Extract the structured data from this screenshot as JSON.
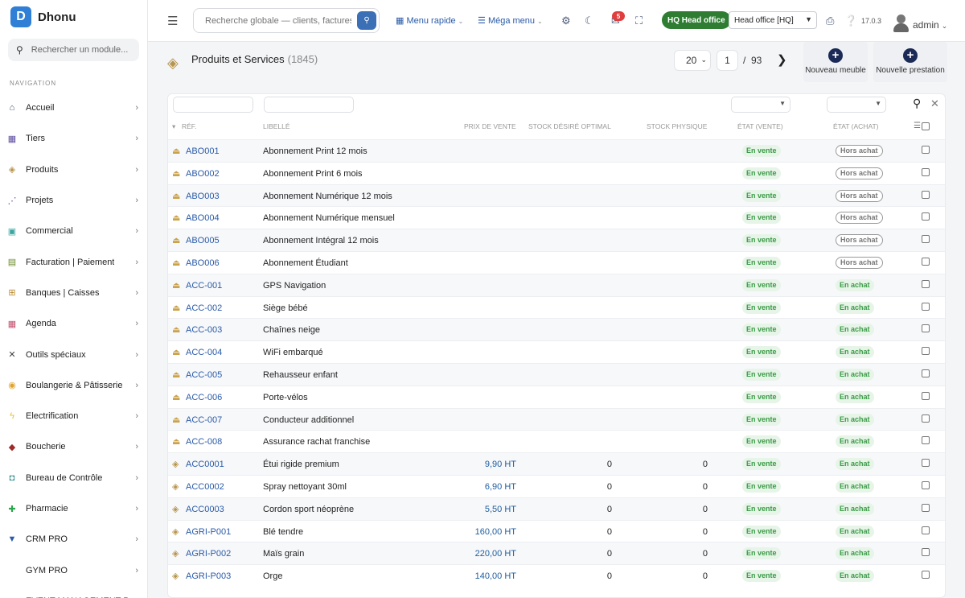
{
  "app": {
    "name": "Dhonu",
    "logo_letter": "D"
  },
  "sidebar": {
    "search_placeholder": "Rechercher un module...",
    "section_title": "NAVIGATION",
    "items": [
      {
        "label": "Accueil",
        "icon": "home-icon",
        "color": "#3b4a6b",
        "glyph": "⌂"
      },
      {
        "label": "Tiers",
        "icon": "building-icon",
        "color": "#5b4a9e",
        "glyph": "▦"
      },
      {
        "label": "Produits",
        "icon": "box-icon",
        "color": "#b8954e",
        "glyph": "◈"
      },
      {
        "label": "Projets",
        "icon": "project-icon",
        "color": "#6a4a9e",
        "glyph": "⋰"
      },
      {
        "label": "Commercial",
        "icon": "briefcase-icon",
        "color": "#3aa6a0",
        "glyph": "▣"
      },
      {
        "label": "Facturation | Paiement",
        "icon": "invoice-icon",
        "color": "#6a8a2a",
        "glyph": "▤"
      },
      {
        "label": "Banques | Caisses",
        "icon": "bank-icon",
        "color": "#b88a2e",
        "glyph": "⊞"
      },
      {
        "label": "Agenda",
        "icon": "calendar-icon",
        "color": "#c0506e",
        "glyph": "▦"
      },
      {
        "label": "Outils spéciaux",
        "icon": "tools-icon",
        "color": "#444",
        "glyph": "✕"
      },
      {
        "label": "Boulangerie & Pâtisserie",
        "icon": "bread-icon",
        "color": "#e0a42e",
        "glyph": "◉"
      },
      {
        "label": "Electrification",
        "icon": "lightning-icon",
        "color": "#e8c12a",
        "glyph": "ϟ"
      },
      {
        "label": "Boucherie",
        "icon": "meat-icon",
        "color": "#9e2a2a",
        "glyph": "◆"
      },
      {
        "label": "Bureau de Contrôle",
        "icon": "control-icon",
        "color": "#2a8a8a",
        "glyph": "◘"
      },
      {
        "label": "Pharmacie",
        "icon": "pharmacy-cross-icon",
        "color": "#2aa64a",
        "glyph": "✚"
      },
      {
        "label": "CRM PRO",
        "icon": "filter-icon",
        "color": "#2a5ba8",
        "glyph": "▼"
      },
      {
        "label": "GYM PRO",
        "icon": "",
        "color": "#fff",
        "glyph": ""
      },
      {
        "label": "EVENT MANAGEMENT P...",
        "icon": "event-icon",
        "color": "#6a3a9e",
        "glyph": "▬"
      }
    ]
  },
  "topbar": {
    "search_placeholder": "Recherche globale — clients, factures, p",
    "menu_rapide": "Menu rapide",
    "mega_menu": "Méga menu",
    "notif_count": "5",
    "hq_badge": "HQ Head office",
    "entity_select": "Head office [HQ]",
    "version": "17.0.3",
    "username": "admin"
  },
  "page": {
    "title": "Produits et Services",
    "count": "(1845)",
    "limit": "20",
    "current_page": "1",
    "page_sep": "/",
    "total_pages": "93",
    "btn_new_furniture": "Nouveau meuble",
    "btn_new_service": "Nouvelle prestation"
  },
  "table": {
    "headers": {
      "ref": "RÉF.",
      "label": "LIBELLÉ",
      "price": "PRIX DE VENTE",
      "stock_desired": "STOCK DÉSIRÉ OPTIMAL",
      "stock_physical": "STOCK PHYSIQUE",
      "state_sell": "ÉTAT (VENTE)",
      "state_buy": "ÉTAT (ACHAT)"
    },
    "rows": [
      {
        "ref": "ABO001",
        "label": "Abonnement Print 12 mois",
        "price": "",
        "stock_desired": "",
        "stock_physical": "",
        "sell": "En vente",
        "buy": "Hors achat",
        "type": "service"
      },
      {
        "ref": "ABO002",
        "label": "Abonnement Print 6 mois",
        "price": "",
        "stock_desired": "",
        "stock_physical": "",
        "sell": "En vente",
        "buy": "Hors achat",
        "type": "service"
      },
      {
        "ref": "ABO003",
        "label": "Abonnement Numérique 12 mois",
        "price": "",
        "stock_desired": "",
        "stock_physical": "",
        "sell": "En vente",
        "buy": "Hors achat",
        "type": "service"
      },
      {
        "ref": "ABO004",
        "label": "Abonnement Numérique mensuel",
        "price": "",
        "stock_desired": "",
        "stock_physical": "",
        "sell": "En vente",
        "buy": "Hors achat",
        "type": "service"
      },
      {
        "ref": "ABO005",
        "label": "Abonnement Intégral 12 mois",
        "price": "",
        "stock_desired": "",
        "stock_physical": "",
        "sell": "En vente",
        "buy": "Hors achat",
        "type": "service"
      },
      {
        "ref": "ABO006",
        "label": "Abonnement Étudiant",
        "price": "",
        "stock_desired": "",
        "stock_physical": "",
        "sell": "En vente",
        "buy": "Hors achat",
        "type": "service"
      },
      {
        "ref": "ACC-001",
        "label": "GPS Navigation",
        "price": "",
        "stock_desired": "",
        "stock_physical": "",
        "sell": "En vente",
        "buy": "En achat",
        "type": "service"
      },
      {
        "ref": "ACC-002",
        "label": "Siège bébé",
        "price": "",
        "stock_desired": "",
        "stock_physical": "",
        "sell": "En vente",
        "buy": "En achat",
        "type": "service"
      },
      {
        "ref": "ACC-003",
        "label": "Chaînes neige",
        "price": "",
        "stock_desired": "",
        "stock_physical": "",
        "sell": "En vente",
        "buy": "En achat",
        "type": "service"
      },
      {
        "ref": "ACC-004",
        "label": "WiFi embarqué",
        "price": "",
        "stock_desired": "",
        "stock_physical": "",
        "sell": "En vente",
        "buy": "En achat",
        "type": "service"
      },
      {
        "ref": "ACC-005",
        "label": "Rehausseur enfant",
        "price": "",
        "stock_desired": "",
        "stock_physical": "",
        "sell": "En vente",
        "buy": "En achat",
        "type": "service"
      },
      {
        "ref": "ACC-006",
        "label": "Porte-vélos",
        "price": "",
        "stock_desired": "",
        "stock_physical": "",
        "sell": "En vente",
        "buy": "En achat",
        "type": "service"
      },
      {
        "ref": "ACC-007",
        "label": "Conducteur additionnel",
        "price": "",
        "stock_desired": "",
        "stock_physical": "",
        "sell": "En vente",
        "buy": "En achat",
        "type": "service"
      },
      {
        "ref": "ACC-008",
        "label": "Assurance rachat franchise",
        "price": "",
        "stock_desired": "",
        "stock_physical": "",
        "sell": "En vente",
        "buy": "En achat",
        "type": "service"
      },
      {
        "ref": "ACC0001",
        "label": "Étui rigide premium",
        "price": "9,90 HT",
        "stock_desired": "0",
        "stock_physical": "0",
        "sell": "En vente",
        "buy": "En achat",
        "type": "product"
      },
      {
        "ref": "ACC0002",
        "label": "Spray nettoyant 30ml",
        "price": "6,90 HT",
        "stock_desired": "0",
        "stock_physical": "0",
        "sell": "En vente",
        "buy": "En achat",
        "type": "product"
      },
      {
        "ref": "ACC0003",
        "label": "Cordon sport néoprène",
        "price": "5,50 HT",
        "stock_desired": "0",
        "stock_physical": "0",
        "sell": "En vente",
        "buy": "En achat",
        "type": "product"
      },
      {
        "ref": "AGRI-P001",
        "label": "Blé tendre",
        "price": "160,00 HT",
        "stock_desired": "0",
        "stock_physical": "0",
        "sell": "En vente",
        "buy": "En achat",
        "type": "product"
      },
      {
        "ref": "AGRI-P002",
        "label": "Maïs grain",
        "price": "220,00 HT",
        "stock_desired": "0",
        "stock_physical": "0",
        "sell": "En vente",
        "buy": "En achat",
        "type": "product"
      },
      {
        "ref": "AGRI-P003",
        "label": "Orge",
        "price": "140,00 HT",
        "stock_desired": "0",
        "stock_physical": "0",
        "sell": "En vente",
        "buy": "En achat",
        "type": "product"
      }
    ]
  },
  "colors": {
    "accent": "#2a5ba8",
    "sell_badge": "#3a9a46",
    "hq_badge": "#2e7d32",
    "notif": "#e03e3e",
    "service_icon": "#c9a24a",
    "product_icon": "#b8954e"
  }
}
